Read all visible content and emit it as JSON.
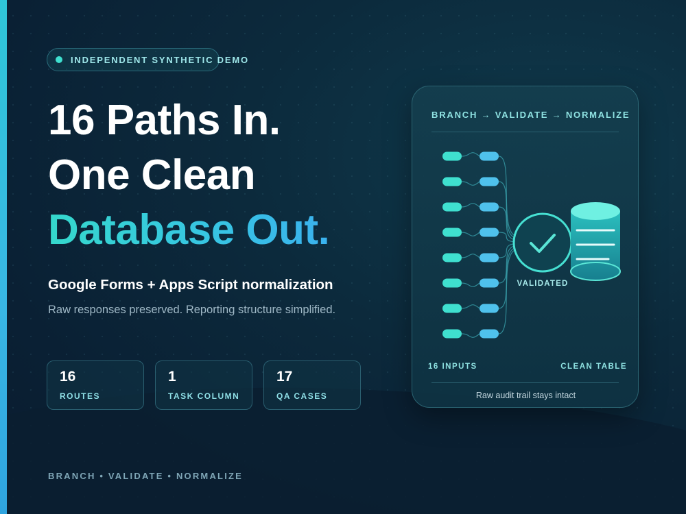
{
  "badge": {
    "text": "INDEPENDENT SYNTHETIC DEMO"
  },
  "headline": {
    "line1": "16 Paths In.",
    "line2": "One Clean",
    "line3": "Database Out."
  },
  "subtitle": "Google Forms + Apps Script normalization",
  "description": "Raw responses preserved. Reporting structure simplified.",
  "stats": [
    {
      "value": "16",
      "label": "ROUTES"
    },
    {
      "value": "1",
      "label": "TASK COLUMN"
    },
    {
      "value": "17",
      "label": "QA CASES"
    }
  ],
  "footer": {
    "text": "BRANCH • VALIDATE • NORMALIZE"
  },
  "card": {
    "title": "BRANCH → VALIDATE → NORMALIZE",
    "validated_label": "VALIDATED",
    "inputs_label": "16 INPUTS",
    "table_label": "CLEAN TABLE",
    "audit_text": "Raw audit trail stays intact",
    "input_rows": 8,
    "inputs_per_row": 2
  },
  "colors": {
    "accent_teal": "#3fe0cf",
    "accent_blue": "#4fc1ec",
    "background": "#0b2336"
  },
  "icons": [
    "status-dot-icon",
    "check-icon",
    "database-icon"
  ]
}
